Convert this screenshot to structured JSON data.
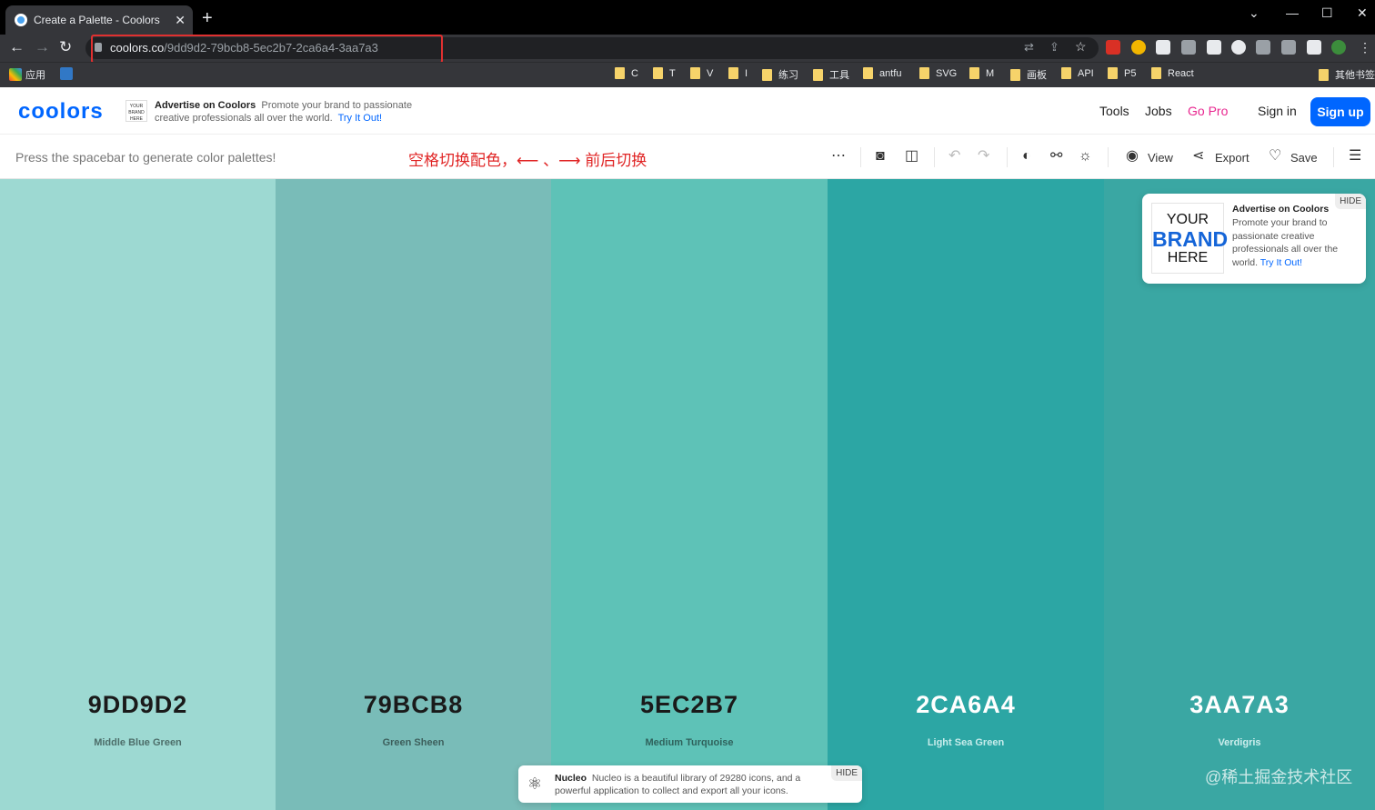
{
  "browser": {
    "tab_title": "Create a Palette - Coolors",
    "tab_close": "✕",
    "new_tab": "+",
    "url_domain": "coolors.co",
    "url_path": "/9dd9d2-79bcb8-5ec2b7-2ca6a4-3aa7a3",
    "bookmarks": [
      {
        "label": "应用",
        "color": "#e8eaed"
      },
      {
        "label": "TS",
        "color": "#3178c6"
      },
      {
        "label": "C"
      },
      {
        "label": "T"
      },
      {
        "label": "V"
      },
      {
        "label": "I"
      },
      {
        "label": "练习"
      },
      {
        "label": "工具"
      },
      {
        "label": "antfu"
      },
      {
        "label": "SVG"
      },
      {
        "label": "M"
      },
      {
        "label": "画板"
      },
      {
        "label": "API"
      },
      {
        "label": "P5"
      },
      {
        "label": "React"
      },
      {
        "label": "其他书签"
      }
    ]
  },
  "header": {
    "logo": "coolors",
    "ad_logo_text": "YOUR BRAND HERE",
    "ad_title": "Advertise on Coolors",
    "ad_body": "Promote your brand to passionate creative professionals all over the world.",
    "ad_link": "Try It Out!",
    "nav": {
      "tools": "Tools",
      "jobs": "Jobs",
      "gopro": "Go Pro",
      "signin": "Sign in",
      "signup": "Sign up"
    }
  },
  "toolbar": {
    "hint": "Press the spacebar to generate color palettes!",
    "annotation": "空格切换配色，⟵ 、⟶ 前后切换",
    "more": "⋯",
    "view": "View",
    "export": "Export",
    "save": "Save"
  },
  "palette": [
    {
      "hex": "9DD9D2",
      "name": "Middle Blue Green",
      "color": "#9dd9d2",
      "text_color": "#1a1a1a",
      "name_color": "#4d6e6a"
    },
    {
      "hex": "79BCB8",
      "name": "Green Sheen",
      "color": "#79bcb8",
      "text_color": "#1a1a1a",
      "name_color": "#3d5f5c"
    },
    {
      "hex": "5EC2B7",
      "name": "Medium Turquoise",
      "color": "#5ec2b7",
      "text_color": "#1a1a1a",
      "name_color": "#2f625c"
    },
    {
      "hex": "2CA6A4",
      "name": "Light Sea Green",
      "color": "#2ca6a4",
      "text_color": "#ffffff",
      "name_color": "#c7eceb"
    },
    {
      "hex": "3AA7A3",
      "name": "Verdigris",
      "color": "#3aa7a3",
      "text_color": "#ffffff",
      "name_color": "#cdeeed"
    }
  ],
  "side_ad": {
    "logo_top": "YOUR",
    "logo_mid": "BRAND",
    "logo_bottom": "HERE",
    "title": "Advertise on Coolors",
    "body": "Promote your brand to passionate creative professionals all over the world.",
    "link": "Try It Out!",
    "hide": "HIDE"
  },
  "bottom_ad": {
    "title": "Nucleo",
    "body": "Nucleo is a beautiful library of 29280 icons, and a powerful application to collect and export all your icons.",
    "hide": "HIDE"
  },
  "watermark": "@稀土掘金技术社区"
}
